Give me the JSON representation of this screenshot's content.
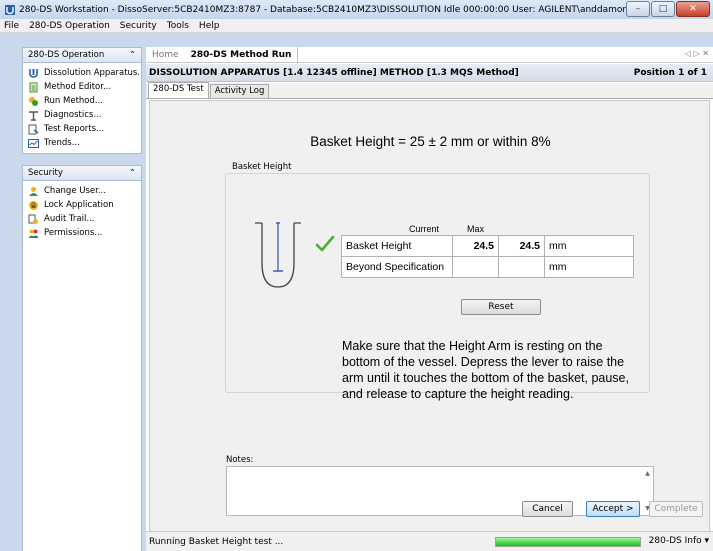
{
  "window": {
    "title": "280-DS Workstation - DissoServer:5CB2410MZ3:8787 - Database:5CB2410MZ3\\DISSOLUTION   Idle 000:00:00  User: AGILENT\\anddamon",
    "minimize": "–",
    "maximize": "□",
    "close": "✕"
  },
  "menu": {
    "items": [
      {
        "label": "File"
      },
      {
        "label": "280-DS Operation"
      },
      {
        "label": "Security"
      },
      {
        "label": "Tools"
      },
      {
        "label": "Help"
      }
    ]
  },
  "nav": {
    "operation": {
      "header": "280-DS Operation",
      "collapse": "⌃",
      "items": [
        {
          "label": "Dissolution Apparatus..."
        },
        {
          "label": "Method Editor..."
        },
        {
          "label": "Run Method..."
        },
        {
          "label": "Diagnostics..."
        },
        {
          "label": "Test Reports..."
        },
        {
          "label": "Trends..."
        }
      ]
    },
    "security": {
      "header": "Security",
      "collapse": "⌃",
      "items": [
        {
          "label": "Change User..."
        },
        {
          "label": "Lock Application"
        },
        {
          "label": "Audit Trail..."
        },
        {
          "label": "Permissions..."
        }
      ]
    }
  },
  "main": {
    "doc_tabs": {
      "home": "Home",
      "active": "280-DS Method Run",
      "nav": "◁ ▷ ✕"
    },
    "header": {
      "text": "DISSOLUTION APPARATUS [1.4 12345 offline] METHOD [1.3 MQS Method]",
      "position": "Position 1 of 1"
    },
    "sub_tabs": [
      {
        "label": "280-DS Test"
      },
      {
        "label": "Activity Log"
      }
    ],
    "headline": "Basket Height = 25 ± 2 mm or within 8%",
    "group_label": "Basket Height",
    "table": {
      "col_current": "Current",
      "col_max": "Max",
      "rows": [
        {
          "label": "Basket Height",
          "current": "24.5",
          "max": "24.5",
          "unit": "mm"
        },
        {
          "label": "Beyond Specification",
          "current": "",
          "max": "",
          "unit": "mm"
        }
      ]
    },
    "reset_label": "Reset",
    "instructions": "Make sure that the Height Arm is resting on the bottom of the vessel. Depress the lever to raise the arm until it touches the bottom of the basket, pause, and release to capture the height reading.",
    "notes_label": "Notes:",
    "notes_value": "",
    "buttons": {
      "cancel": "Cancel",
      "accept": "Accept >",
      "complete": "Complete"
    }
  },
  "status": {
    "text": "Running Basket Height test ...",
    "progress": 1.0,
    "info": "280-DS Info ▾"
  },
  "colors": {
    "accent": "#3c7fb1",
    "check": "#4caf35",
    "progress": "#1cbd1c",
    "nav_bg": "#c9d8ea"
  }
}
